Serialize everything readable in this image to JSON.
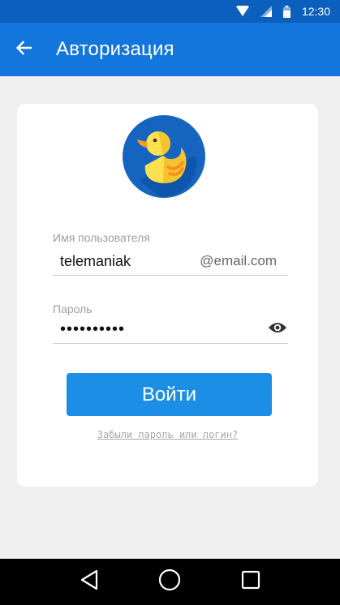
{
  "status_bar": {
    "time": "12:30",
    "icons": [
      "wifi-icon",
      "cell-signal-icon",
      "battery-icon"
    ]
  },
  "app_bar": {
    "title": "Авторизация",
    "back_icon": "arrow-back-icon"
  },
  "form": {
    "username_label": "Имя пользователя",
    "username_value": "telemaniak",
    "email_suffix": "@email.com",
    "password_label": "Пароль",
    "password_value": "••••••••••",
    "password_toggle_icon": "eye-icon",
    "login_button": "Войти",
    "forgot_link": "Забыли пароль или логин?"
  },
  "logo": {
    "icon": "duck-logo"
  },
  "nav_bar": {
    "icons": [
      "back-triangle-icon",
      "home-circle-icon",
      "recents-square-icon"
    ]
  },
  "colors": {
    "app_bar": "#1276dc",
    "status_bar": "#0c5fbd",
    "button": "#1c8ee6",
    "logo_background": "#1565c0",
    "duck_yellow": "#ffe14d"
  }
}
